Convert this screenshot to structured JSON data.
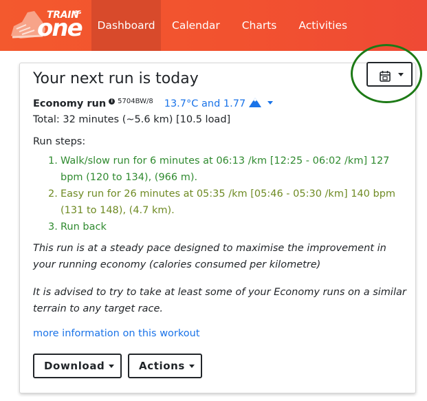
{
  "brand": {
    "line1": "TRAIN",
    "small": "AS",
    "line2": "one"
  },
  "nav": {
    "items": [
      {
        "label": "Dashboard",
        "active": true
      },
      {
        "label": "Calendar"
      },
      {
        "label": "Charts"
      },
      {
        "label": "Activities"
      }
    ]
  },
  "card": {
    "title": "Your next run is today",
    "date_button_icon": "calendar-today-icon",
    "workout_name": "Economy run",
    "workout_code": "5704BW/8",
    "weather": "13.7°C and 1.77",
    "weather_icon": "mountain-icon",
    "total": "Total: 32 minutes (~5.6 km) [10.5 load]",
    "steps_label": "Run steps:",
    "steps": [
      {
        "num": "1.",
        "text": "Walk/slow run for 6 minutes at 06:13 /km [12:25 - 06:02 /km] 127 bpm (120 to 134), (966 m)."
      },
      {
        "num": "2.",
        "text": "Easy run for 26 minutes at 05:35 /km [05:46 - 05:30 /km] 140 bpm (131 to 148), (4.7 km)."
      },
      {
        "num": "3.",
        "text": "Run back"
      }
    ],
    "description_1": "This run is at a steady pace designed to maximise the improvement in your running economy (calories consumed per kilometre)",
    "description_2": "It is advised to try to take at least some of your Economy runs on a similar terrain to any target race.",
    "more_link": "more information on this workout",
    "download_label": "Download",
    "actions_label": "Actions"
  },
  "colors": {
    "nav_bg": "#f2522f",
    "nav_active": "#d84a2b",
    "link": "#1a73e8",
    "step_green": "#2f8a2f",
    "step_olive": "#6e8a23",
    "highlight_ring": "#1d7a16"
  }
}
